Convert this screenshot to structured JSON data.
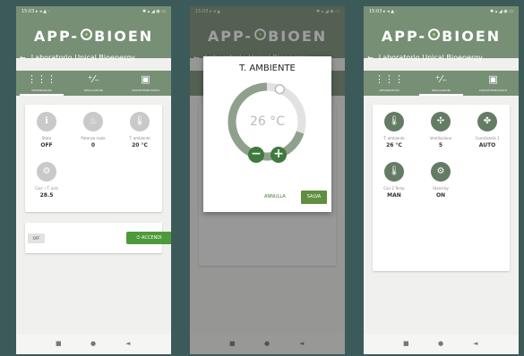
{
  "app": {
    "status_left": "15:03 ▸ ◂ ▲ ·",
    "status_right": "✱ ▴ ◢ ◉ ▭",
    "logo_left": "APP-",
    "logo_right": "BIOEN",
    "subtitle": "Laboratorio Unical Bioenergy",
    "tabs": [
      {
        "label": "INFORMAZIONI",
        "icon": "grid-icon"
      },
      {
        "label": "REGOLAZIONI",
        "icon": "plus-minus-icon"
      },
      {
        "label": "CRONOTERMOSTATO",
        "icon": "calendar-icon"
      }
    ]
  },
  "screen1": {
    "items": [
      {
        "name": "Stato",
        "value": "OFF",
        "icon": "info-icon"
      },
      {
        "name": "Potenza reale",
        "value": "0",
        "icon": "flame-icon"
      },
      {
        "name": "T. ambiente",
        "value": "20 °C",
        "icon": "thermometer-icon"
      },
      {
        "name": "Carr. / T. arià",
        "value": "28.5",
        "icon": "gear-icon"
      }
    ],
    "off_label": "OFF",
    "on_label": "ACCENDI"
  },
  "screen2": {
    "dialog_title": "T. AMBIENTE",
    "temperature": "26 °C",
    "temperature_level": 0.7,
    "cancel_label": "ANNULLA",
    "save_label": "SALVA"
  },
  "screen3": {
    "items": [
      {
        "name": "T. ambiente",
        "value": "26 °C",
        "icon": "thermometer-icon"
      },
      {
        "name": "Ventilazione",
        "value": "5",
        "icon": "fan-icon"
      },
      {
        "name": "Canalizzata 1",
        "value": "AUTO",
        "icon": "fan-icon"
      },
      {
        "name": "Can 2 Temp",
        "value": "MAN",
        "icon": "thermometer-icon"
      },
      {
        "name": "Stand by",
        "value": "ON",
        "icon": "gear-icon"
      }
    ]
  },
  "nav": {
    "square": "■",
    "circle": "●",
    "back": "◄"
  },
  "colors": {
    "header": "#778f75",
    "accent_green": "#4d9a3a",
    "icon_green": "#647c64",
    "icon_grey": "#c9c9c9"
  }
}
